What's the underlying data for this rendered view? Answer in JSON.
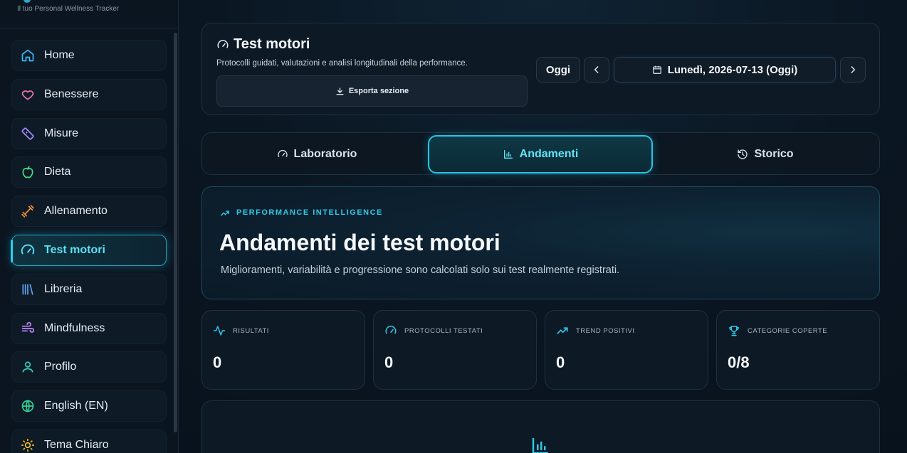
{
  "brand": {
    "tagline": "Il tuo Personal Wellness Tracker"
  },
  "sidebar": {
    "items": [
      {
        "label": "Home",
        "icon": "home-icon"
      },
      {
        "label": "Benessere",
        "icon": "heart-icon"
      },
      {
        "label": "Misure",
        "icon": "ruler-icon"
      },
      {
        "label": "Dieta",
        "icon": "apple-icon"
      },
      {
        "label": "Allenamento",
        "icon": "dumbbell-icon"
      },
      {
        "label": "Test motori",
        "icon": "gauge-icon",
        "active": true
      },
      {
        "label": "Libreria",
        "icon": "library-icon"
      },
      {
        "label": "Mindfulness",
        "icon": "wind-icon"
      },
      {
        "label": "Profilo",
        "icon": "user-icon"
      },
      {
        "label": "English (EN)",
        "icon": "globe-icon"
      },
      {
        "label": "Tema Chiaro",
        "icon": "sun-icon"
      }
    ]
  },
  "header": {
    "title": "Test motori",
    "description": "Protocolli guidati, valutazioni e analisi longitudinali della performance.",
    "export_label": "Esporta sezione",
    "today_label": "Oggi",
    "date_label": "Lunedì, 2026-07-13 (Oggi)"
  },
  "tabs": [
    {
      "label": "Laboratorio",
      "icon": "gauge-icon"
    },
    {
      "label": "Andamenti",
      "icon": "bar-chart-icon",
      "active": true
    },
    {
      "label": "Storico",
      "icon": "history-icon"
    }
  ],
  "hero": {
    "eyebrow": "PERFORMANCE INTELLIGENCE",
    "title": "Andamenti dei test motori",
    "subtitle": "Miglioramenti, variabilità e progressione sono calcolati solo sui test realmente registrati."
  },
  "stats": [
    {
      "label": "RISULTATI",
      "value": "0",
      "icon": "activity-icon"
    },
    {
      "label": "PROTOCOLLI TESTATI",
      "value": "0",
      "icon": "gauge-icon"
    },
    {
      "label": "TREND POSITIVI",
      "value": "0",
      "icon": "trending-up-icon"
    },
    {
      "label": "CATEGORIE COPERTE",
      "value": "0/8",
      "icon": "trophy-icon"
    }
  ],
  "colors": {
    "accent": "#22d3ee",
    "background": "#0a1420"
  }
}
